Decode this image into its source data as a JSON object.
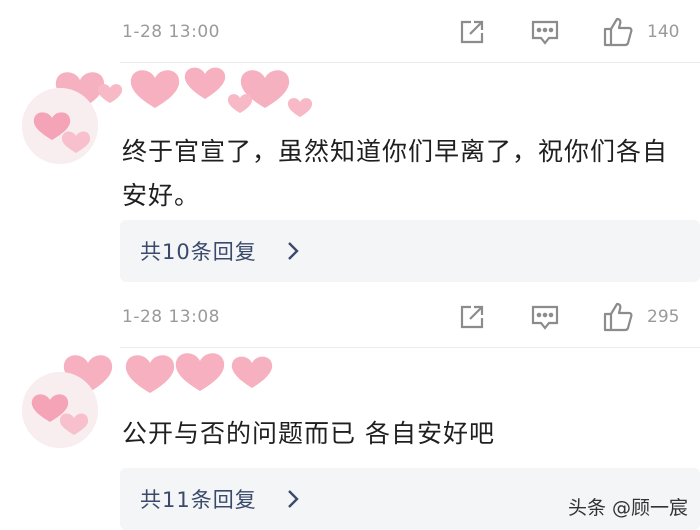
{
  "comments": [
    {
      "meta": {
        "time": "1-28  13:00",
        "likes": "140"
      },
      "text": "终于官宣了，虽然知道你们早离了，祝你们各自安好。",
      "replies_label": "共10条回复"
    },
    {
      "meta": {
        "time": "1-28  13:08",
        "likes": "295"
      },
      "text": "公开与否的问题而已  各自安好吧",
      "replies_label": "共11条回复"
    }
  ],
  "watermark": "头条 @顾一宸",
  "colors": {
    "meta_gray": "#9a9a9a",
    "reply_bg": "#f4f5f7",
    "reply_text": "#3b4a6b",
    "heart_pink": "#f5a3b5"
  },
  "icons": [
    "share-icon",
    "comment-icon",
    "thumbs-up-icon",
    "chevron-right-icon"
  ]
}
